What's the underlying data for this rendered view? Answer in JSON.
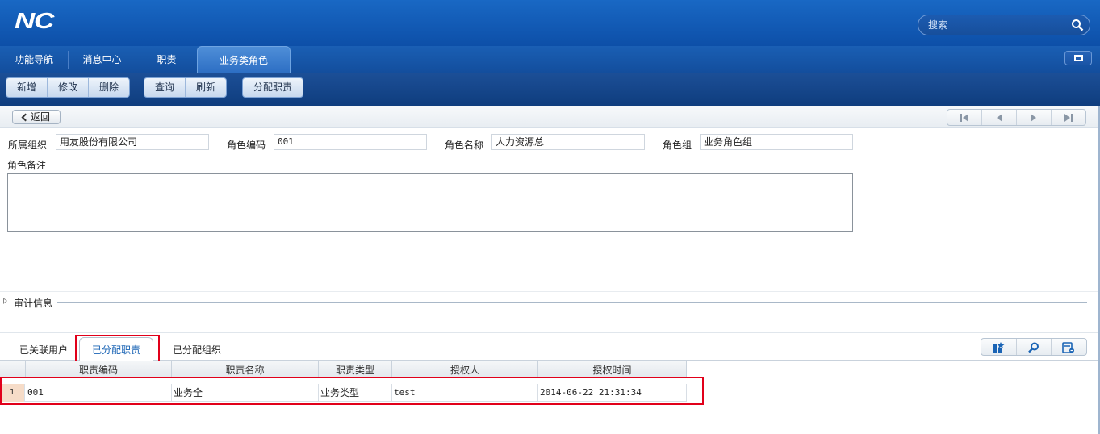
{
  "app": {
    "logo": "NC"
  },
  "search": {
    "placeholder": "搜索",
    "icon": "search-icon"
  },
  "nav": {
    "tabs": [
      {
        "label": "功能导航"
      },
      {
        "label": "消息中心"
      },
      {
        "label": "职责"
      },
      {
        "label": "业务类角色",
        "active": true
      }
    ]
  },
  "toolbar": {
    "add": "新增",
    "edit": "修改",
    "delete": "删除",
    "query": "查询",
    "refresh": "刷新",
    "assign": "分配职责"
  },
  "subbar": {
    "back": "返回"
  },
  "form": {
    "org_label": "所属组织",
    "org_value": "用友股份有限公司",
    "code_label": "角色编码",
    "code_value": "001",
    "name_label": "角色名称",
    "name_value": "人力资源总",
    "group_label": "角色组",
    "group_value": "业务角色组",
    "remark_label": "角色备注",
    "remark_value": ""
  },
  "audit": {
    "label": "审计信息"
  },
  "bottom_tabs": [
    {
      "label": "已关联用户"
    },
    {
      "label": "已分配职责",
      "active": true
    },
    {
      "label": "已分配组织"
    }
  ],
  "grid": {
    "columns": [
      "职责编码",
      "职责名称",
      "职责类型",
      "授权人",
      "授权时间"
    ],
    "rows": [
      {
        "num": "1",
        "code": "001",
        "name": "业务全",
        "type": "业务类型",
        "grantor": "test",
        "time": "2014-06-22 21:31:34"
      }
    ]
  },
  "colors": {
    "brand_blue": "#0d4fa8",
    "highlight_red": "#e1001a"
  }
}
